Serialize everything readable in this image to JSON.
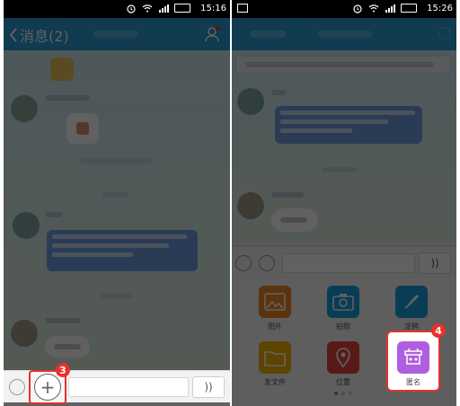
{
  "left_screen": {
    "status_time": "15:16",
    "title": "消息(2)",
    "back_symbol": "<",
    "voice_symbol": "))",
    "plus_symbol": "+",
    "step_badge": "3",
    "message_bubble_text": "..."
  },
  "right_screen": {
    "status_time": "15:26",
    "voice_symbol": "))",
    "step_badge": "4",
    "panel_items": [
      {
        "label": "图片",
        "icon": "image-icon",
        "color": "#f08a24"
      },
      {
        "label": "拍照",
        "icon": "camera-icon",
        "color": "#1aa0e0"
      },
      {
        "label": "涂鸦",
        "icon": "brush-icon",
        "color": "#1aa0e0"
      },
      {
        "label": "发文件",
        "icon": "folder-icon",
        "color": "#f3b400"
      },
      {
        "label": "位置",
        "icon": "location-icon",
        "color": "#e8443a"
      },
      {
        "label": "匿名",
        "icon": "anonymous-icon",
        "color": "#b05ee0"
      }
    ]
  },
  "colors": {
    "titlebar": "#2a9bd6",
    "highlight": "#e8302a"
  }
}
